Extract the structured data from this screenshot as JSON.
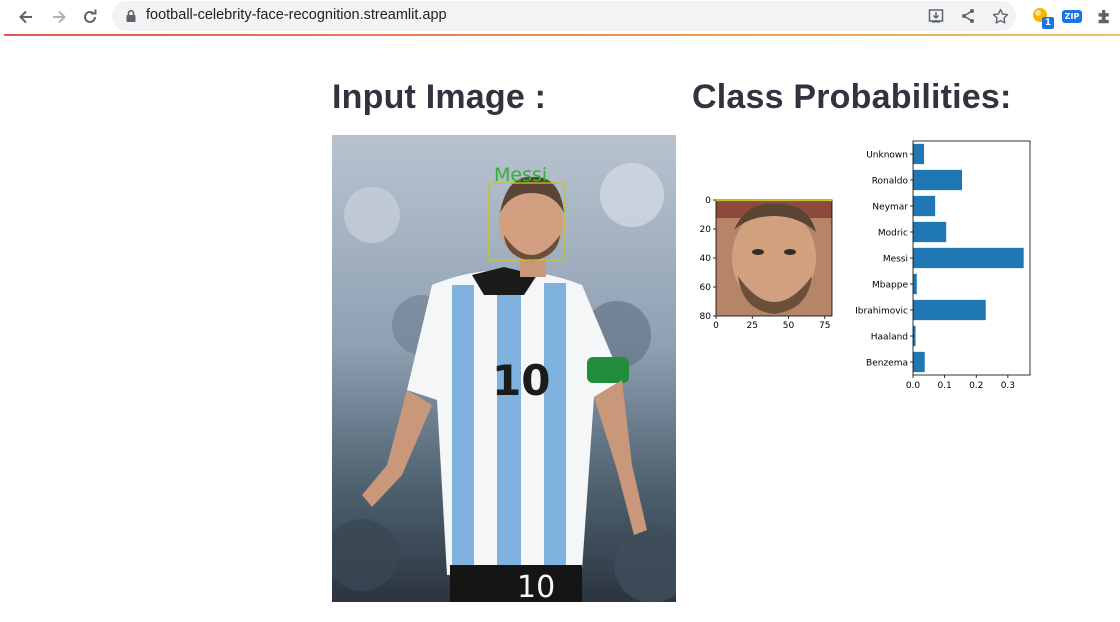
{
  "browser": {
    "url": "football-celebrity-face-recognition.streamlit.app",
    "extension_badge_count": "1",
    "zip_badge": "ZIP"
  },
  "main": {
    "input_heading": "Input Image :",
    "probabilities_heading": "Class Probabilities:",
    "detection_label": "Messi"
  },
  "face_crop_axes": {
    "x_ticks": [
      "0",
      "25",
      "50",
      "75"
    ],
    "y_ticks": [
      "0",
      "20",
      "40",
      "60",
      "80"
    ]
  },
  "chart_data": {
    "type": "bar",
    "orientation": "horizontal",
    "categories": [
      "Unknown",
      "Ronaldo",
      "Neymar",
      "Modric",
      "Messi",
      "Mbappe",
      "Ibrahimovic",
      "Haaland",
      "Benzema"
    ],
    "values": [
      0.035,
      0.155,
      0.07,
      0.105,
      0.35,
      0.012,
      0.23,
      0.008,
      0.037
    ],
    "x_ticks": [
      "0.0",
      "0.1",
      "0.2",
      "0.3"
    ],
    "xlim": [
      0,
      0.37
    ],
    "bar_color": "#1f77b4",
    "title": "",
    "xlabel": "",
    "ylabel": ""
  }
}
